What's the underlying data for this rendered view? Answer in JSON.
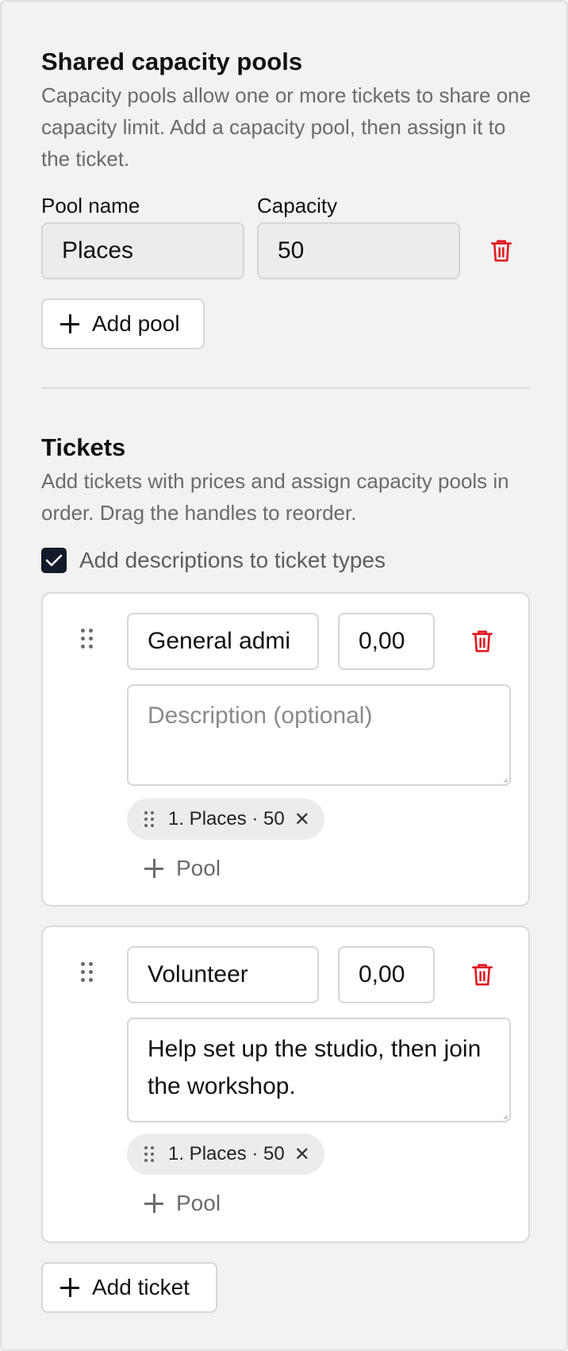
{
  "pools_section": {
    "title": "Shared capacity pools",
    "description": "Capacity pools allow one or more tickets to share one capacity limit. Add a capacity pool, then assign it to the ticket.",
    "pool_name_label": "Pool name",
    "capacity_label": "Capacity",
    "pools": [
      {
        "name": "Places",
        "capacity": "50"
      }
    ],
    "add_pool_label": "Add pool"
  },
  "tickets_section": {
    "title": "Tickets",
    "description": "Add tickets with prices and assign capacity pools in order. Drag the handles to reorder.",
    "descriptions_checkbox": {
      "label": "Add descriptions to ticket types",
      "checked": true
    },
    "tickets": [
      {
        "name": "General admi",
        "price": "0,00",
        "description_placeholder": "Description (optional)",
        "description": "",
        "pool_chip": "1. Places · 50",
        "add_pool_label": "Pool"
      },
      {
        "name": "Volunteer",
        "price": "0,00",
        "description_placeholder": "Description (optional)",
        "description": "Help set up the studio, then join the workshop.",
        "pool_chip": "1. Places · 50",
        "add_pool_label": "Pool"
      }
    ],
    "add_ticket_label": "Add ticket"
  },
  "icons": {
    "trash": "trash-icon",
    "plus": "plus-icon",
    "drag": "drag-handle-icon",
    "close": "close-icon",
    "check": "check-icon"
  },
  "colors": {
    "danger": "#e0161e",
    "checkbox": "#121a2b",
    "muted_text": "#6b6b6b",
    "background": "#f2f2f2"
  }
}
